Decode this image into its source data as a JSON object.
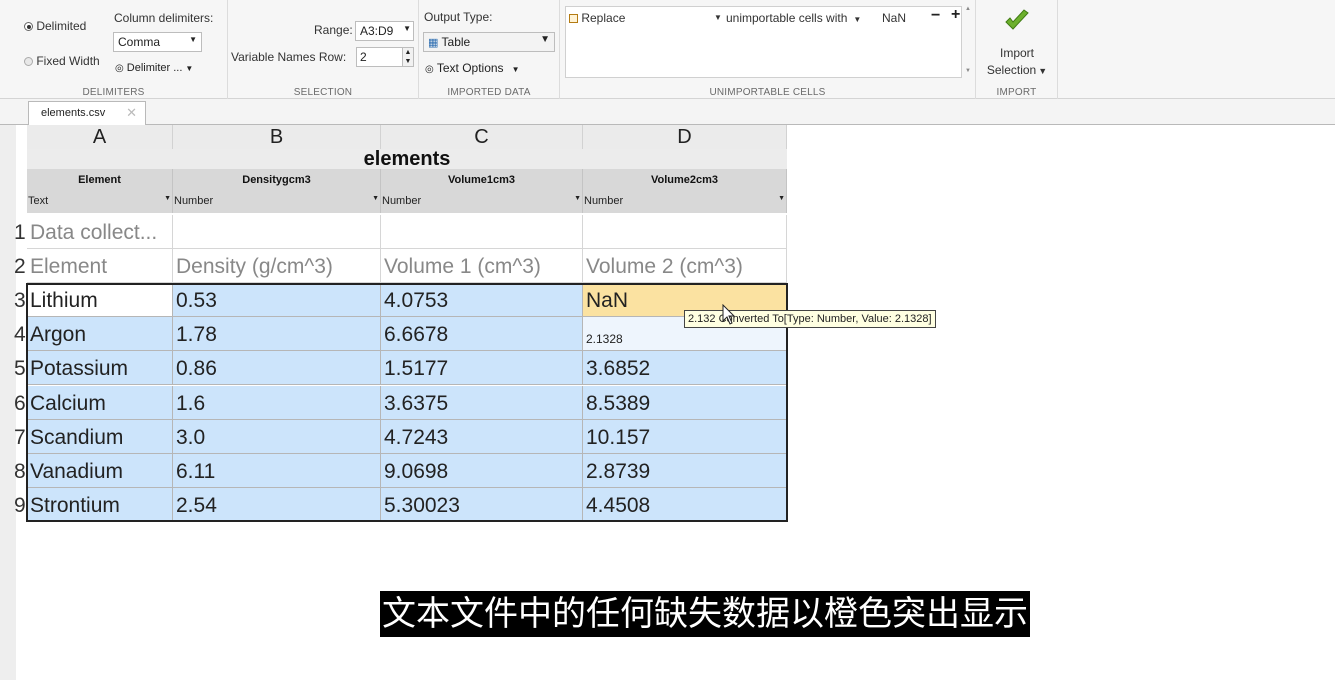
{
  "delimiters": {
    "section_label": "DELIMITERS",
    "delimited_label": "Delimited",
    "fixed_width_label": "Fixed Width",
    "column_delimiters_label": "Column delimiters:",
    "delimiter_value": "Comma",
    "delimiter_options_label": "Delimiter ..."
  },
  "selection": {
    "section_label": "SELECTION",
    "range_label": "Range:",
    "range_value": "A3:D9",
    "var_names_row_label": "Variable Names Row:",
    "var_names_row_value": "2"
  },
  "imported_data": {
    "section_label": "IMPORTED DATA",
    "output_type_label": "Output Type:",
    "output_type_value": "Table",
    "text_options_label": "Text Options"
  },
  "unimportable_cells": {
    "section_label": "UNIMPORTABLE CELLS",
    "rule_action": "Replace",
    "rule_condition": "unimportable cells with",
    "rule_value": "NaN",
    "minus_label": "−",
    "plus_label": "+"
  },
  "import": {
    "section_label": "IMPORT",
    "button_line1": "Import",
    "button_line2": "Selection"
  },
  "file_tab": {
    "name": "elements.csv",
    "close_glyph": "✕"
  },
  "grid": {
    "columns": [
      "A",
      "B",
      "C",
      "D"
    ],
    "table_name": "elements",
    "var_names": [
      "Element",
      "Densitygcm3",
      "Volume1cm3",
      "Volume2cm3"
    ],
    "var_types": [
      "Text",
      "Number",
      "Number",
      "Number"
    ],
    "row_numbers": [
      "1",
      "2",
      "3",
      "4",
      "5",
      "6",
      "7",
      "8",
      "9"
    ],
    "rows": [
      [
        "Data collect...",
        "",
        "",
        ""
      ],
      [
        "Element",
        "Density (g/cm^3)",
        "Volume 1 (cm^3)",
        "Volume 2 (cm^3)"
      ],
      [
        "Lithium",
        "0.53",
        "4.0753",
        "NaN"
      ],
      [
        "Argon",
        "1.78",
        "6.6678",
        "2.1328"
      ],
      [
        "Potassium",
        "0.86",
        "1.5177",
        "3.6852"
      ],
      [
        "Calcium",
        "1.6",
        "3.6375",
        "8.5389"
      ],
      [
        "Scandium",
        "3.0",
        "4.7243",
        "10.157"
      ],
      [
        "Vanadium",
        "6.11",
        "9.0698",
        "2.8739"
      ],
      [
        "Strontium",
        "2.54",
        "5.30023",
        "4.4508"
      ]
    ]
  },
  "tooltip": {
    "text": "2.132 Converted To[Type: Number, Value: 2.1328]"
  },
  "subtitle": {
    "text": "文本文件中的任何缺失数据以橙色突出显示"
  },
  "colors": {
    "selected": "#cce4fb",
    "missing_highlight": "#fbe2a1",
    "import_check": "#5aa01e"
  }
}
